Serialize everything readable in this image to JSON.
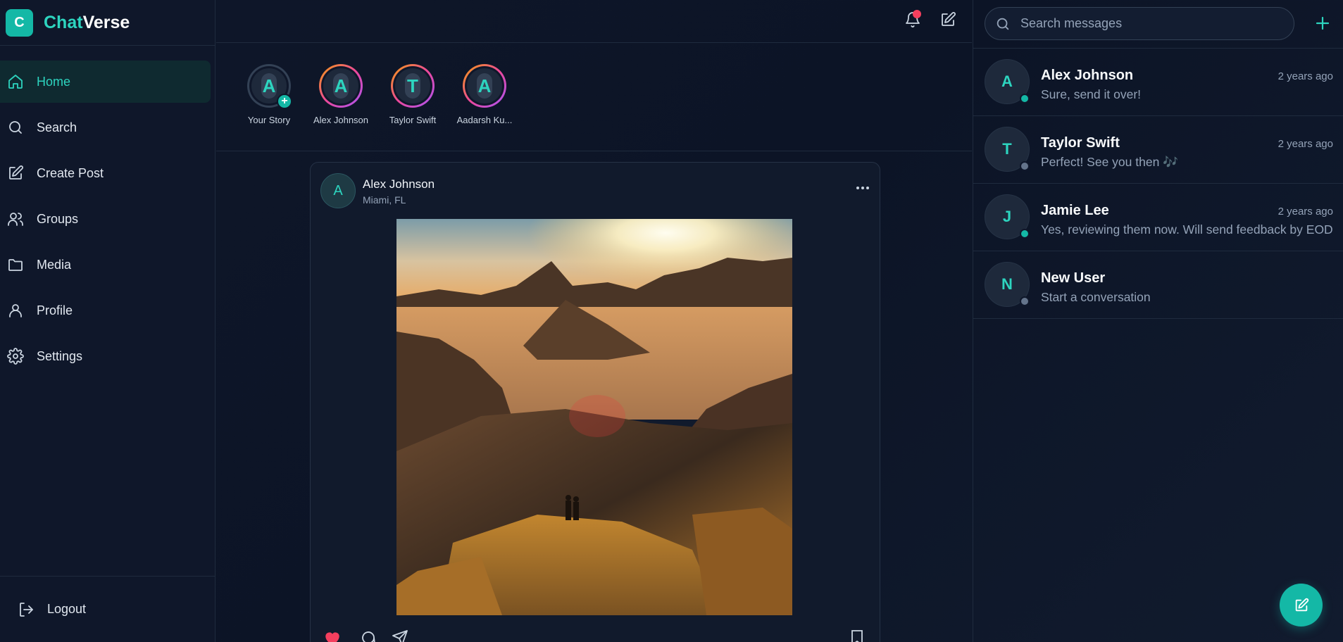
{
  "brand": {
    "logo_letter": "C",
    "name_accent": "Chat",
    "name_rest": "Verse"
  },
  "sidebar": {
    "items": [
      {
        "label": "Home",
        "icon": "home-icon",
        "active": true
      },
      {
        "label": "Search",
        "icon": "search-icon"
      },
      {
        "label": "Create Post",
        "icon": "edit-icon"
      },
      {
        "label": "Groups",
        "icon": "users-icon"
      },
      {
        "label": "Media",
        "icon": "folder-icon"
      },
      {
        "label": "Profile",
        "icon": "user-icon"
      },
      {
        "label": "Settings",
        "icon": "gear-icon"
      }
    ],
    "logout_label": "Logout"
  },
  "topbar": {
    "notification_icon": "bell-icon",
    "compose_icon": "edit-icon"
  },
  "stories": [
    {
      "name": "Your Story",
      "initial": "A",
      "own": true
    },
    {
      "name": "Alex Johnson",
      "initial": "A"
    },
    {
      "name": "Taylor Swift",
      "initial": "T"
    },
    {
      "name": "Aadarsh Ku...",
      "initial": "A"
    }
  ],
  "post": {
    "author": "Alex Johnson",
    "initial": "A",
    "location": "Miami, FL",
    "liked": true,
    "accent_like": "#f43f5e"
  },
  "messages": {
    "search_placeholder": "Search messages",
    "conversations": [
      {
        "name": "Alex Johnson",
        "initial": "A",
        "time": "2 years ago",
        "preview": "Sure, send it over!",
        "online": true
      },
      {
        "name": "Taylor Swift",
        "initial": "T",
        "time": "2 years ago",
        "preview": "Perfect! See you then 🎶",
        "online": false
      },
      {
        "name": "Jamie Lee",
        "initial": "J",
        "time": "2 years ago",
        "preview": "Yes, reviewing them now. Will send feedback by EOD",
        "online": true
      },
      {
        "name": "New User",
        "initial": "N",
        "time": "",
        "preview": "Start a conversation",
        "online": false
      }
    ]
  },
  "colors": {
    "accent": "#2dd4bf",
    "online": "#14b8a6",
    "offline": "#64748b",
    "notification": "#f43f5e"
  }
}
